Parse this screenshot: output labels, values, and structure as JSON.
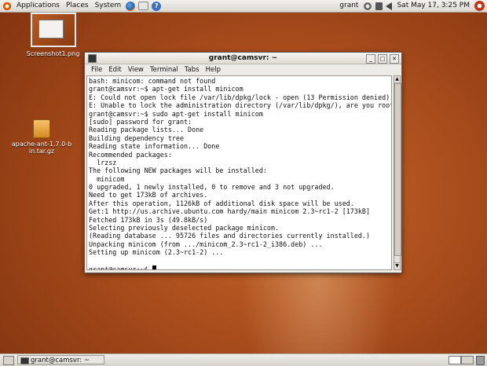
{
  "top_panel": {
    "menus": [
      "Applications",
      "Places",
      "System"
    ],
    "username": "grant",
    "clock": "Sat May 17,  3:25 PM"
  },
  "desktop": {
    "icons": [
      {
        "label": "Screenshot1.png"
      },
      {
        "label": "apache-ant-1.7.0-bin.tar.gz"
      }
    ]
  },
  "window": {
    "title": "grant@camsvr: ~",
    "menu": [
      "File",
      "Edit",
      "View",
      "Terminal",
      "Tabs",
      "Help"
    ],
    "terminal_lines": [
      "bash: minicom: command not found",
      "grant@camsvr:~$ apt-get install minicom",
      "E: Could not open lock file /var/lib/dpkg/lock - open (13 Permission denied)",
      "E: Unable to lock the administration directory (/var/lib/dpkg/), are you root?",
      "grant@camsvr:~$ sudo apt-get install minicom",
      "[sudo] password for grant:",
      "Reading package lists... Done",
      "Building dependency tree",
      "Reading state information... Done",
      "Recommended packages:",
      "  lrzsz",
      "The following NEW packages will be installed:",
      "  minicom",
      "0 upgraded, 1 newly installed, 0 to remove and 3 not upgraded.",
      "Need to get 173kB of archives.",
      "After this operation, 1126kB of additional disk space will be used.",
      "Get:1 http://us.archive.ubuntu.com hardy/main minicom 2.3~rc1-2 [173kB]",
      "Fetched 173kB in 3s (49.8kB/s)",
      "Selecting previously deselected package minicom.",
      "(Reading database ... 95726 files and directories currently installed.)",
      "Unpacking minicom (from .../minicom_2.3~rc1-2_i386.deb) ...",
      "Setting up minicom (2.3~rc1-2) ...",
      "",
      "grant@camsvr:~$ "
    ]
  },
  "bottom_panel": {
    "task_label": "grant@camsvr: ~"
  }
}
